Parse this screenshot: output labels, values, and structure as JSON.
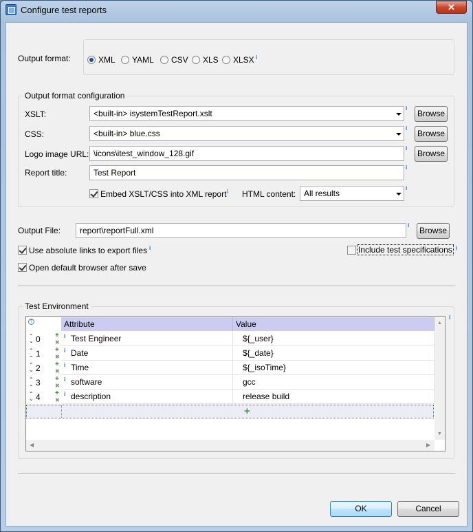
{
  "window": {
    "title": "Configure test reports",
    "close_label": "✕"
  },
  "output_format": {
    "label": "Output format:",
    "options": [
      {
        "label": "XML",
        "selected": true
      },
      {
        "label": "YAML",
        "selected": false
      },
      {
        "label": "CSV",
        "selected": false
      },
      {
        "label": "XLS",
        "selected": false
      },
      {
        "label": "XLSX",
        "selected": false
      }
    ]
  },
  "config": {
    "group_title": "Output format configuration",
    "xslt": {
      "label": "XSLT:",
      "value": "<built-in> isystemTestReport.xslt",
      "browse": "Browse"
    },
    "css": {
      "label": "CSS:",
      "value": "<built-in> blue.css",
      "browse": "Browse"
    },
    "logo": {
      "label": "Logo image URL:",
      "value": "\\icons\\itest_window_128.gif",
      "browse": "Browse"
    },
    "report_title": {
      "label": "Report title:",
      "value": "Test Report"
    },
    "embed": {
      "label": "Embed XSLT/CSS into XML report",
      "checked": true
    },
    "html_content": {
      "label": "HTML content:",
      "value": "All results"
    }
  },
  "output_file": {
    "label": "Output File:",
    "value": "report\\reportFull.xml",
    "browse": "Browse"
  },
  "options": {
    "absolute_links": {
      "label": "Use absolute links to export files",
      "checked": true
    },
    "include_specs": {
      "label": "Include test specifications",
      "checked": false
    },
    "open_browser": {
      "label": "Open default browser after save",
      "checked": true
    }
  },
  "test_env": {
    "group_title": "Test Environment",
    "help_icon": "?",
    "columns": [
      "Attribute",
      "Value"
    ],
    "rows": [
      {
        "index": "0",
        "attribute": "Test Engineer",
        "value": "${_user}"
      },
      {
        "index": "1",
        "attribute": "Date",
        "value": "${_date}"
      },
      {
        "index": "2",
        "attribute": "Time",
        "value": "${_isoTime}"
      },
      {
        "index": "3",
        "attribute": "software",
        "value": "gcc"
      },
      {
        "index": "4",
        "attribute": "description",
        "value": "release build"
      }
    ],
    "add_icon": "+"
  },
  "buttons": {
    "ok": "OK",
    "cancel": "Cancel"
  },
  "info_marker": "i"
}
